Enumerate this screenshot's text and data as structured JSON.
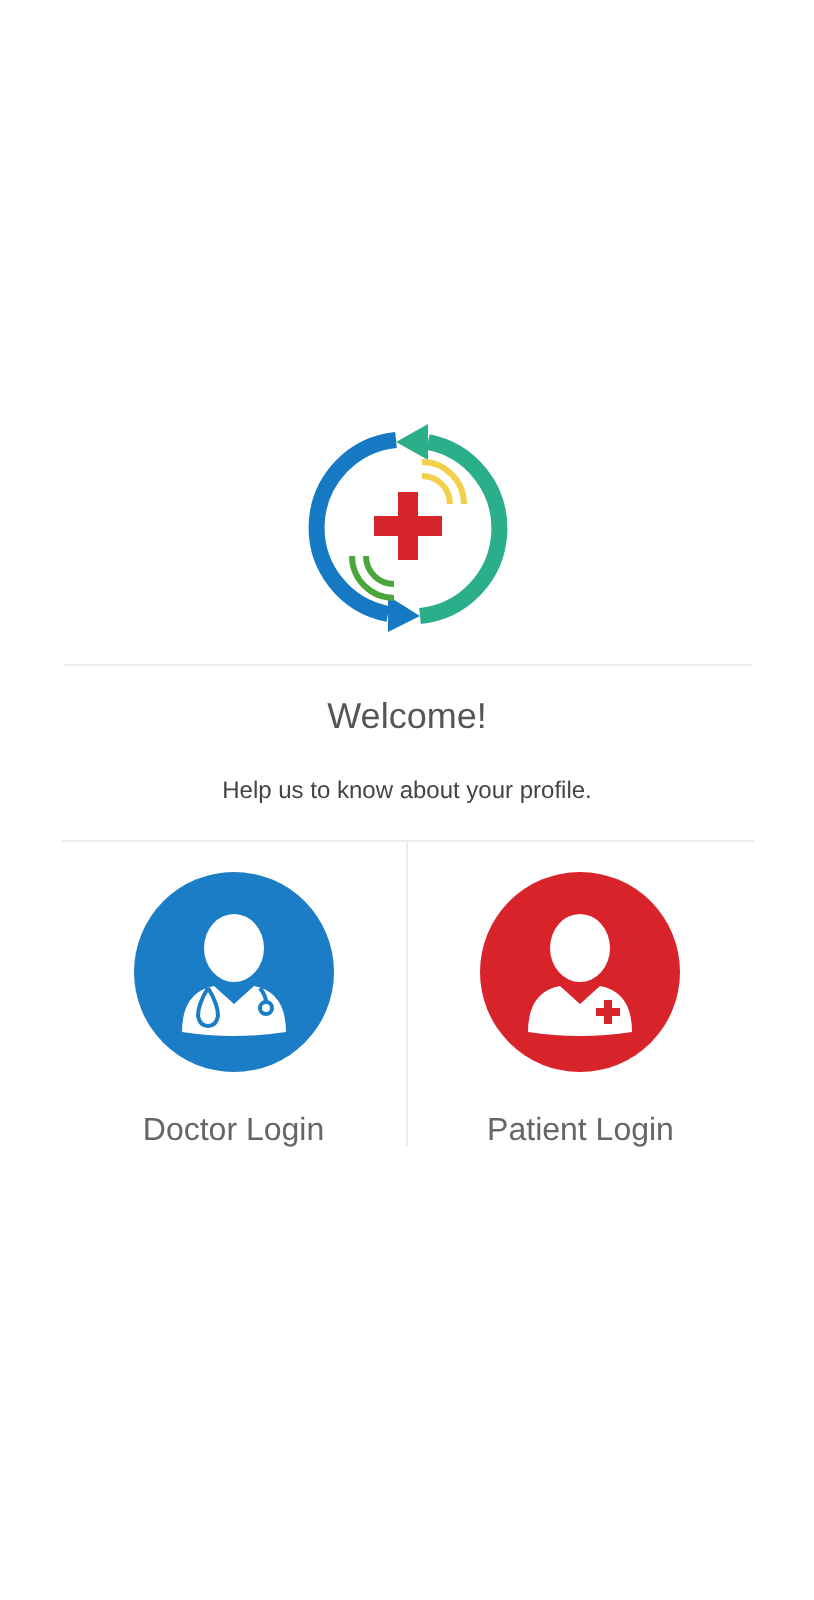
{
  "welcome": {
    "title": "Welcome!",
    "subtitle": "Help us to know about your profile."
  },
  "login_options": [
    {
      "kind": "doctor",
      "label": "Doctor Login"
    },
    {
      "kind": "patient",
      "label": "Patient Login"
    }
  ]
}
